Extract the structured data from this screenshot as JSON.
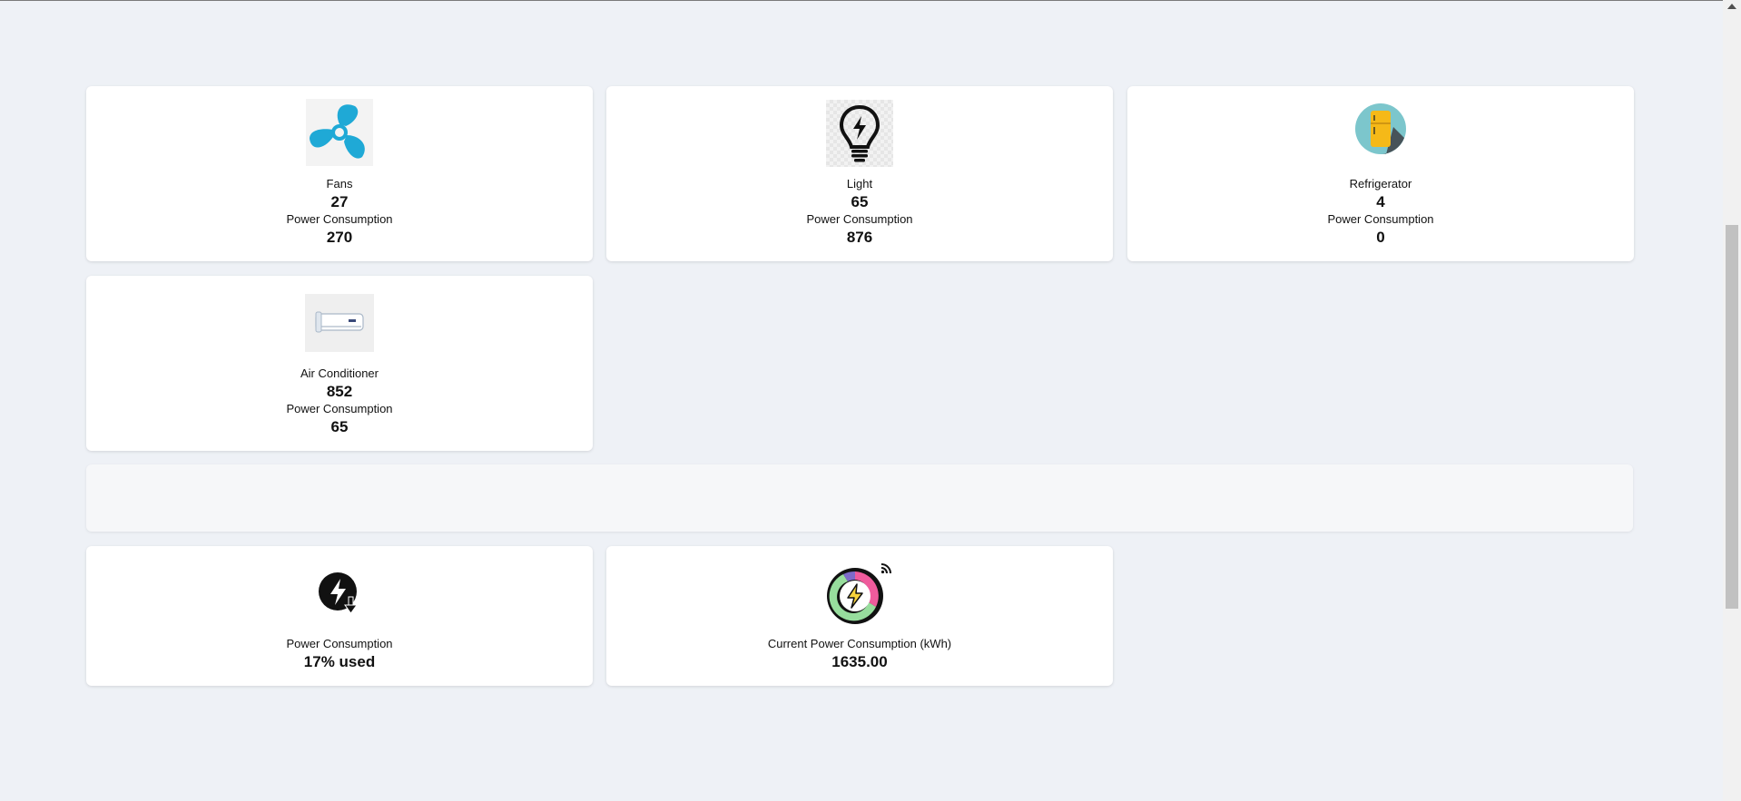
{
  "devices": [
    {
      "name": "Fans",
      "count": "27",
      "power_label": "Power Consumption",
      "power_value": "270",
      "icon": "fan-icon"
    },
    {
      "name": "Light",
      "count": "65",
      "power_label": "Power Consumption",
      "power_value": "876",
      "icon": "light-bulb-icon"
    },
    {
      "name": "Refrigerator",
      "count": "4",
      "power_label": "Power Consumption",
      "power_value": "0",
      "icon": "refrigerator-icon"
    },
    {
      "name": "Air Conditioner",
      "count": "852",
      "power_label": "Power Consumption",
      "power_value": "65",
      "icon": "air-conditioner-icon"
    }
  ],
  "summary": {
    "usage": {
      "label": "Power Consumption",
      "value": "17% used",
      "icon": "power-usage-icon"
    },
    "current": {
      "label": "Current Power Consumption (kWh)",
      "value": "1635.00",
      "icon": "power-meter-icon"
    }
  },
  "colors": {
    "background": "#eef1f6",
    "fan_blue": "#1fa9d6",
    "fridge_yellow": "#f5b918",
    "fridge_circle": "#7cc6cc",
    "meter_pink": "#ef5b9c",
    "meter_green": "#97dd9d",
    "meter_purple": "#7d6ac9"
  }
}
